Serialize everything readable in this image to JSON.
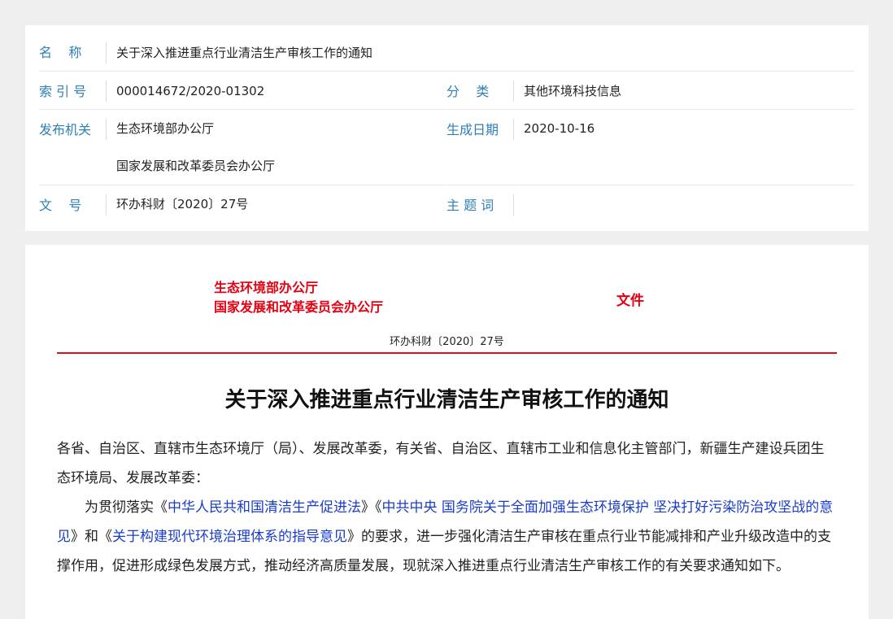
{
  "meta": {
    "name_label": "名    称",
    "name_value": "关于深入推进重点行业清洁生产审核工作的通知",
    "index_label": "索 引 号",
    "index_value": "000014672/2020-01302",
    "category_label": "分    类",
    "category_value": "其他环境科技信息",
    "issuer_label": "发布机关",
    "issuer_value_1": "生态环境部办公厅",
    "issuer_value_2": "国家发展和改革委员会办公厅",
    "date_label": "生成日期",
    "date_value": "2020-10-16",
    "docno_label": "文    号",
    "docno_value": "环办科财〔2020〕27号",
    "keyword_label": "主 题 词",
    "keyword_value": ""
  },
  "document": {
    "issuer_1": "生态环境部办公厅",
    "issuer_2": "国家发展和改革委员会办公厅",
    "wenjian": "文件",
    "doc_number": "环办科财〔2020〕27号",
    "title": "关于深入推进重点行业清洁生产审核工作的通知",
    "recipients": "各省、自治区、直辖市生态环境厅（局）、发展改革委，有关省、自治区、直辖市工业和信息化主管部门，新疆生产建设兵团生态环境局、发展改革委：",
    "p1_pre": "为贯彻落实《",
    "link_1": "中华人民共和国清洁生产促进法",
    "p1_mid1": "》《",
    "link_2": "中共中央 国务院关于全面加强生态环境保护 坚决打好污染防治攻坚战的意见",
    "p1_mid2": "》和《",
    "link_3": "关于构建现代环境治理体系的指导意见",
    "p1_post": "》的要求，进一步强化清洁生产审核在重点行业节能减排和产业升级改造中的支撑作用，促进形成绿色发展方式，推动经济高质量发展，现就深入推进重点行业清洁生产审核工作的有关要求通知如下。"
  }
}
